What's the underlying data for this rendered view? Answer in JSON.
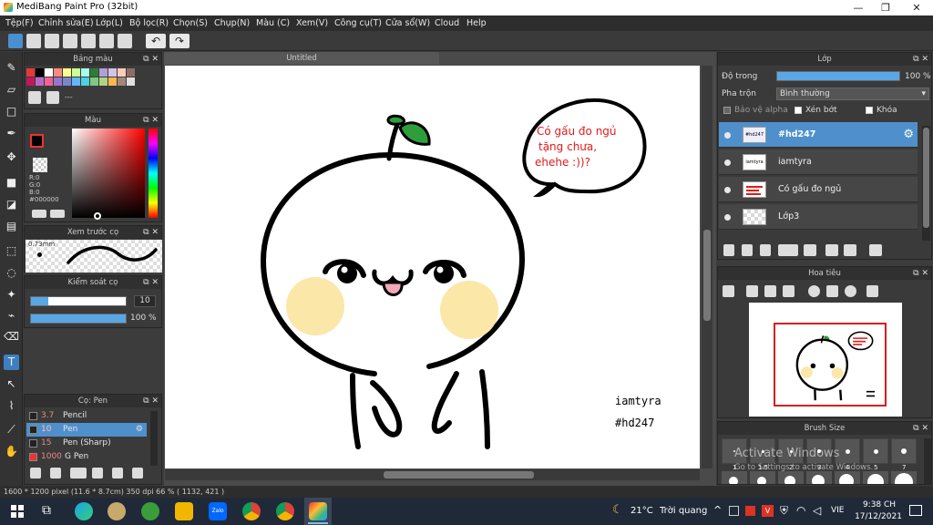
{
  "window": {
    "title": "MediBang Paint Pro (32bit)",
    "min": "—",
    "max": "❐",
    "close": "✕"
  },
  "menu": [
    "Tệp(F)",
    "Chỉnh sửa(E)",
    "Lớp(L)",
    "Bộ lọc(R)",
    "Chọn(S)",
    "Chụp(N)",
    "Màu (C)",
    "Xem(V)",
    "Công cụ(T)",
    "Cửa sổ(W)",
    "Cloud",
    "Help"
  ],
  "document": {
    "tab": "Untitled"
  },
  "panels": {
    "palette": {
      "title": "Bảng màu",
      "dashes": "---"
    },
    "color": {
      "title": "Màu",
      "r": "R:0",
      "g": "G:0",
      "b": "B:0",
      "hex": "#000000"
    },
    "brush_preview": {
      "title": "Xem trước cọ",
      "size": "0.73mm"
    },
    "brush_control": {
      "title": "Kiểm soát cọ",
      "size_value": "10",
      "opacity_value": "100 %"
    },
    "brush_list": {
      "title": "Cọ: Pen",
      "items": [
        {
          "num": "3.7",
          "name": "Pencil"
        },
        {
          "num": "10",
          "name": "Pen"
        },
        {
          "num": "15",
          "name": "Pen (Sharp)"
        },
        {
          "num": "1000",
          "name": "G Pen"
        }
      ]
    },
    "layers": {
      "title": "Lớp",
      "opacity_label": "Độ trong",
      "opacity_value": "100 %",
      "blend_label": "Pha trộn",
      "blend_value": "Bình thường",
      "protect_alpha": "Bảo vệ alpha",
      "clipping": "Xén bớt",
      "lock": "Khóa",
      "items": [
        {
          "name": "#hd247",
          "thumb": "#hd247"
        },
        {
          "name": "iamtyra",
          "thumb": "iamtyra"
        },
        {
          "name": "Có gấu đo ngủ",
          "thumb": ""
        },
        {
          "name": "Lớp3",
          "thumb": ""
        }
      ]
    },
    "navigator": {
      "title": "Hoa tiêu"
    },
    "brush_size": {
      "title": "Brush Size",
      "labels": [
        "1",
        "1.5",
        "2",
        "3",
        "4",
        "5",
        "7"
      ],
      "watermark_title": "Activate Windows",
      "watermark_sub": "Go to Settings to activate Windows."
    }
  },
  "artwork": {
    "bubble_text": [
      "Có gấu đo ngủ",
      "tặng chưa,",
      "ehehe :))?"
    ],
    "signature": "iamtyra",
    "tag": "#hd247"
  },
  "status": {
    "text": "1600 * 1200 pixel   (11.6 * 8.7cm)   350 dpi   66 %   ( 1132, 421 )"
  },
  "taskbar": {
    "weather_temp": "21°C",
    "weather_text": "Trời quang",
    "lang": "VIE",
    "time": "9:38 CH",
    "date": "17/12/2021"
  },
  "colors": {
    "accent": "#4f90cc",
    "bear_green": "#2e9e3c",
    "cheek": "#fbe7a8",
    "bubble_text": "#e21b1b",
    "nav_frame": "#d61f1f"
  }
}
